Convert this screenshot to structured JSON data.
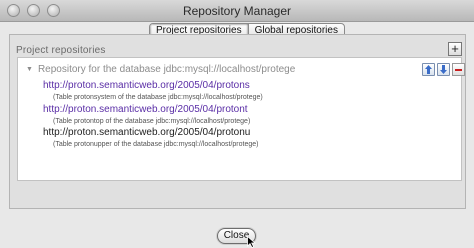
{
  "window": {
    "title": "Repository Manager"
  },
  "tabs": [
    {
      "label": "Project repositories",
      "active": true
    },
    {
      "label": "Global repositories",
      "active": false
    }
  ],
  "group": {
    "title": "Project repositories",
    "add_button": "+"
  },
  "repository": {
    "header": "Repository for the database jdbc:mysql://localhost/protege",
    "entries": [
      {
        "url": "http://proton.semanticweb.org/2005/04/protons",
        "description": "(Table protonsystem of the database jdbc:mysql://localhost/protege)",
        "style": "link"
      },
      {
        "url": "http://proton.semanticweb.org/2005/04/protont",
        "description": "(Table protontop of the database jdbc:mysql://localhost/protege)",
        "style": "link"
      },
      {
        "url": "http://proton.semanticweb.org/2005/04/protonu",
        "description": "(Table protonupper of the database jdbc:mysql://localhost/protege)",
        "style": "plain"
      }
    ]
  },
  "toolbar_icons": [
    "move-up-icon",
    "move-down-icon",
    "remove-icon"
  ],
  "footer": {
    "close_label": "Close"
  },
  "colors": {
    "link": "#5a2ea6",
    "plain_url": "#222222",
    "remove": "#c81f1f"
  }
}
